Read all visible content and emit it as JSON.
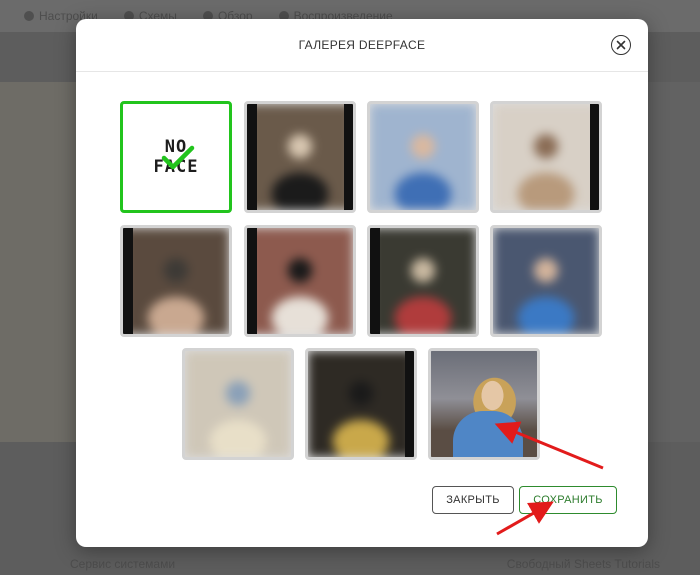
{
  "background_nav": {
    "items": [
      {
        "label": "Настройки",
        "icon": "gear-icon"
      },
      {
        "label": "Схемы",
        "icon": "folder-icon"
      },
      {
        "label": "Обзор",
        "icon": "eye-icon"
      },
      {
        "label": "Воспроизведение",
        "icon": "play-icon"
      }
    ]
  },
  "background_footer": {
    "left": "Сервис системами",
    "right": "Свободный Sheets Tutorials"
  },
  "modal": {
    "title": "ГАЛЕРЕЯ DEEPFACE",
    "close_icon": "close-icon",
    "no_face_tile": {
      "line1": "NO",
      "line2": "FACE",
      "check_icon": "checkmark-icon",
      "selected": true
    },
    "tiles": [
      {
        "id": "photo-1",
        "colors": [
          "#6a5a4a",
          "#1b1b1b",
          "#d7c6b0"
        ]
      },
      {
        "id": "photo-2",
        "colors": [
          "#9fb4cf",
          "#3f6fb5",
          "#d9b8a0"
        ]
      },
      {
        "id": "photo-3",
        "colors": [
          "#d8d0c6",
          "#b89a7c",
          "#8a6c55"
        ]
      },
      {
        "id": "photo-4",
        "colors": [
          "#5a4a3e",
          "#c9a890",
          "#3d3a36"
        ]
      },
      {
        "id": "photo-5",
        "colors": [
          "#8d5a4e",
          "#e7e0d8",
          "#1a1a1a"
        ]
      },
      {
        "id": "photo-6",
        "colors": [
          "#3a3a32",
          "#b03c3c",
          "#c8b8a0"
        ]
      },
      {
        "id": "photo-7",
        "colors": [
          "#4a5770",
          "#3b79c4",
          "#d2b39b"
        ]
      },
      {
        "id": "photo-8",
        "colors": [
          "#cfc7b8",
          "#e8dfc8",
          "#8aa0b8"
        ]
      },
      {
        "id": "photo-9",
        "colors": [
          "#2e2a24",
          "#c9a84a",
          "#1a1a1a"
        ]
      },
      {
        "id": "photo-10",
        "colors": [
          "#6b6e78",
          "#e5c7a6",
          "#4f86c6"
        ]
      }
    ],
    "buttons": {
      "close_label": "ЗАКРЫТЬ",
      "save_label": "СОХРАНИТЬ"
    }
  },
  "colors": {
    "selected_border": "#22c41d",
    "save_text": "#2e7d2e",
    "arrow": "#e21b1b"
  }
}
